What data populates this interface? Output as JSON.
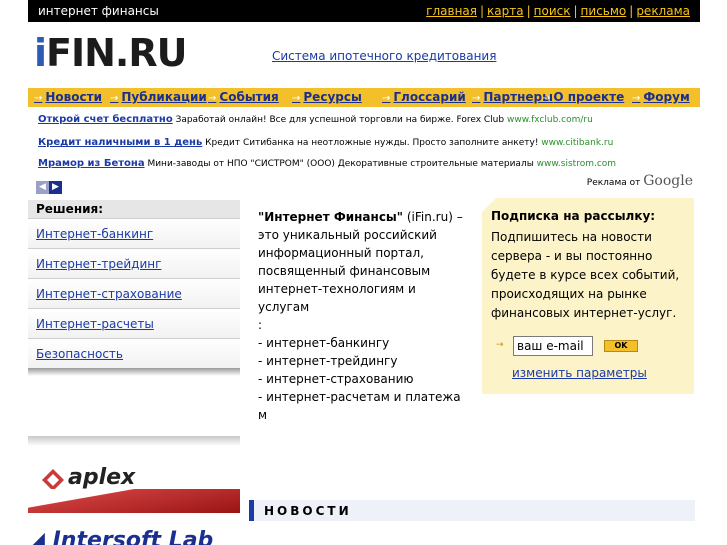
{
  "topbar": {
    "site_name": "интернет финансы",
    "links": [
      "главная",
      "карта",
      "поиск",
      "письмо",
      "реклама"
    ]
  },
  "logo": {
    "i": "i",
    "rest": "FIN.RU"
  },
  "mortgage_link": "Система ипотечного кредитования",
  "nav": {
    "items": [
      "Новости",
      "Публикации",
      "События",
      "Ресурсы",
      "Глоссарий",
      "Партнеры",
      "О проекте",
      "Форум"
    ]
  },
  "ads": [
    {
      "title": "Открой счет бесплатно",
      "text": " Заработай онлайн! Все для успешной торговли на бирже. Forex Club ",
      "url": "www.fxclub.com/ru"
    },
    {
      "title": "Кредит наличными в 1 день",
      "text": " Кредит Ситибанка на неотложные нужды. Просто заполните анкету! ",
      "url": "www.citibank.ru"
    },
    {
      "title": "Мрамор из Бетона",
      "text": " Мини-заводы от НПО \"СИСТРОМ\" (ООО) Декоративные строительные материалы ",
      "url": "www.sistrom.com"
    }
  ],
  "ads_by": {
    "prefix": "Реклама от ",
    "brand": "Google"
  },
  "sidebar": {
    "head": "Решения:",
    "items": [
      "Интернет-банкинг",
      "Интернет-трейдинг",
      "Интернет-страхование",
      "Интернет-расчеты",
      "Безопасность"
    ]
  },
  "banners": {
    "aplex": "aplex",
    "intersoft": "Intersoft Lab"
  },
  "intro": {
    "name": "\"Интернет Финансы\"",
    "line1": " (iFin.ru) –",
    "line2": "это уникальный российский",
    "line3": "информационный портал,",
    "line4": "посвященный финансовым",
    "line5": "интернет-технологиям и услугам",
    "line6": ":",
    "items": [
      "- интернет-банкингу",
      "- интернет-трейдингу",
      "- интернет-страхованию",
      "- интернет-расчетам и платежа",
      "м"
    ]
  },
  "subscribe": {
    "title": "Подписка на рассылку:",
    "text": "Подпишитесь на новости сервера - и вы постоянно будете в курсе всех событий, происходящих на рынке финансовых интернет-услуг.",
    "email_value": "ваш e-mail",
    "ok_label": "OK",
    "params_link": "изменить параметры"
  },
  "news": {
    "label": "НОВОСТИ"
  }
}
